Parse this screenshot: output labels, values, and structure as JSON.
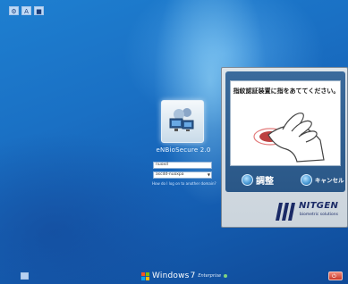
{
  "top_bar": {
    "icons": [
      "settings-icon",
      "language-icon",
      "monitor-icon"
    ]
  },
  "login": {
    "user_name": "eNBioSecure 2.0",
    "username_value": "nuoxd",
    "domain_value": "ascdd-nuoxpa",
    "link_text": "How do I log on to another domain?"
  },
  "fingerprint_dialog": {
    "instruction": "指紋認証装置に指をあててください。",
    "adjust_label": "調整",
    "cancel_label": "キャンセル",
    "brand_name": "NITGEN",
    "brand_tagline": "biometric solutions"
  },
  "bottom_bar": {
    "windows_label": "Windows",
    "version_label": "7",
    "edition_label": "Enterprise"
  },
  "colors": {
    "desktop_blue": "#1a70c4",
    "dialog_blue": "#2a5787",
    "brand_navy": "#1a2a66",
    "shutdown_red": "#c8382a"
  }
}
